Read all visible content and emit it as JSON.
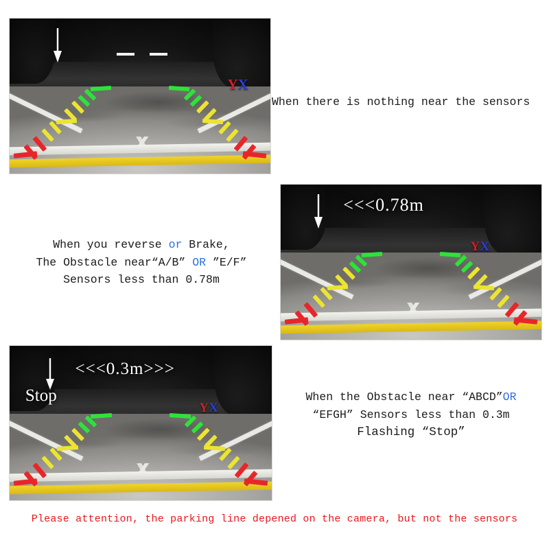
{
  "page": {
    "background": "#ffffff",
    "highlight_color": "#2f6fe0",
    "warning_color": "#e8161f",
    "logo_y_color": "#c8232b",
    "logo_x_color": "#2b3fd8",
    "guide_green": "#2ee23a",
    "guide_yellow": "#ece431",
    "guide_red": "#e8262a"
  },
  "panels": [
    {
      "id": "panel-no-obstacle",
      "logo": {
        "y": "Y",
        "x": "X"
      },
      "overlay_distance": "",
      "overlay_stop": "",
      "has_dashes": true,
      "has_arrow": true
    },
    {
      "id": "panel-078m",
      "logo": {
        "y": "Y",
        "x": "X"
      },
      "overlay_distance": "<<<0.78m",
      "overlay_stop": "",
      "has_dashes": false,
      "has_arrow": true
    },
    {
      "id": "panel-03m",
      "logo": {
        "y": "Y",
        "x": "X"
      },
      "overlay_distance": "<<<0.3m>>>",
      "overlay_stop": "Stop",
      "has_dashes": false,
      "has_arrow": true
    }
  ],
  "captions": {
    "caption_no_obstacle": "When there is nothing near the sensors",
    "caption_reverse": {
      "line1_a": "When you reverse ",
      "line1_hl": "or",
      "line1_b": " Brake,",
      "line2_a": "The Obstacle near“A/B” ",
      "line2_hl": "OR",
      "line2_b": " ”E/F”",
      "line3": "Sensors less than 0.78m"
    },
    "caption_stop": {
      "line1_a": "When the Obstacle near “ABCD”",
      "line1_hl": "OR",
      "line2": "“EFGH” Sensors less than 0.3m",
      "line3": "Flashing “Stop”"
    }
  },
  "footnote": "Please attention, the parking line depened on the camera, but not the sensors"
}
